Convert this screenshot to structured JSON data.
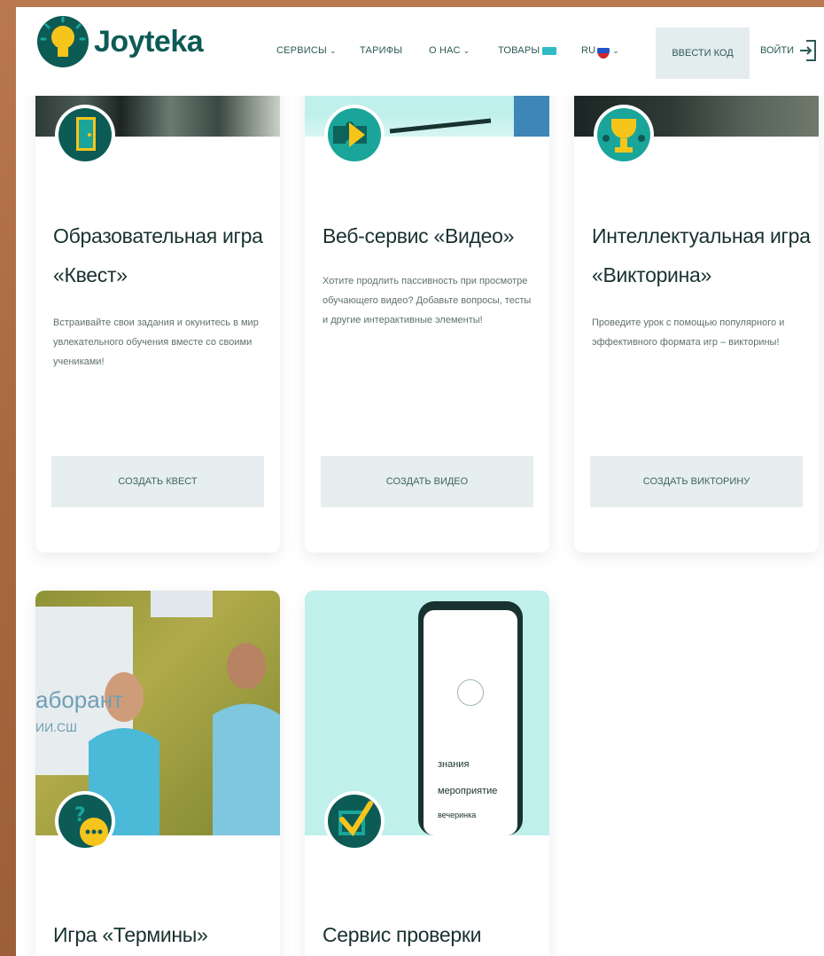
{
  "header": {
    "brand": "Joyteka",
    "nav": [
      {
        "label": "СЕРВИСЫ",
        "chevron": "chevron-down-icon"
      },
      {
        "label": "ТАРИФЫ"
      },
      {
        "label": "О НАС",
        "chevron": "chevron-down-icon"
      },
      {
        "label": "ТОВАРЫ",
        "badge": true
      }
    ],
    "language": "RU",
    "enter_code": "ВВЕСТИ КОД",
    "login": "ВОЙТИ"
  },
  "cards": [
    {
      "title_line1": "Образовательная игра",
      "title_line2": "«Квест»",
      "desc": "Встраивайте свои задания и окунитесь в мир увлекательного обучения вместе со своими учениками!",
      "button": "СОЗДАТЬ КВЕСТ",
      "icon": "door-icon"
    },
    {
      "title_line1": "Веб-сервис «Видео»",
      "title_line2": "",
      "desc": "Хотите продлить пассивность при просмотре обучающего видео? Добавьте вопросы, тесты и другие интерактивные элементы!",
      "button": "СОЗДАТЬ ВИДЕО",
      "icon": "play-puzzle-icon"
    },
    {
      "title_line1": "Интеллектуальная игра",
      "title_line2": "«Викторина»",
      "desc": "Проведите урок с помощью популярного и эффективного формата игр – викторины!",
      "button": "СОЗДАТЬ ВИКТОРИНУ",
      "icon": "trophy-icon"
    },
    {
      "title_line1": "Игра «Термины»",
      "title_line2": "",
      "icon": "question-chat-icon",
      "photo_text_1": "аборант",
      "photo_text_2": "ИИ.СШ"
    },
    {
      "title_line1": "Сервис проверки знаний",
      "title_line2": "",
      "icon": "checkmark-icon",
      "phone_options": [
        "знания",
        "мероприятие",
        "вечеринка"
      ]
    }
  ],
  "colors": {
    "brand": "#0d5b55",
    "accent_yellow": "#f6c51b",
    "teal": "#1aa59b",
    "light_cyan": "#bff0ec"
  }
}
